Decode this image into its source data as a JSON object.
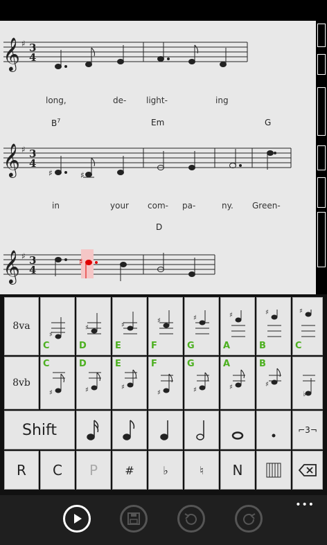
{
  "score": {
    "lyrics_line1": [
      "long,",
      "de-",
      "light-",
      "ing"
    ],
    "chords_line2": [
      "B",
      "Em",
      "G"
    ],
    "chord_b_sup": "7",
    "lyrics_line2": [
      "in",
      "your",
      "com-",
      "pa-",
      "ny.",
      "Green-"
    ],
    "chords_line3": [
      "D"
    ],
    "time_signature_top": "3",
    "time_signature_bottom": "4",
    "selected_note_color": "#e00000"
  },
  "keyboard": {
    "octave_up_label": "8va",
    "octave_down_label": "8vb",
    "note_names": [
      "C",
      "D",
      "E",
      "F",
      "G",
      "A",
      "B",
      "C"
    ],
    "note_names_low": [
      "C",
      "D",
      "E",
      "F",
      "G",
      "A",
      "B"
    ],
    "shift_label": "Shift",
    "triplet_label": "3",
    "bottom_row": [
      "R",
      "C",
      "P",
      "#",
      "♭",
      "♮",
      "N"
    ],
    "label_color": "#4cb020"
  },
  "appbar": {
    "more_label": "•••"
  }
}
